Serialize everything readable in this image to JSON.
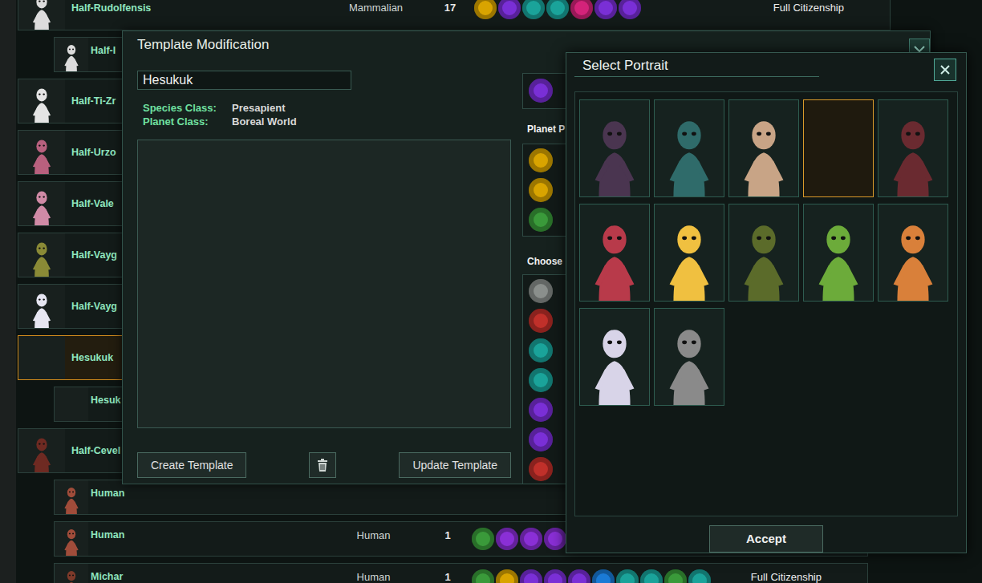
{
  "species_list": {
    "rows": [
      {
        "name": "Half-Rudolfensis",
        "kind": "species",
        "selected": false,
        "portrait_kind": "figure",
        "portrait_color": "#dcdcdc",
        "class": "Mammalian",
        "count": "17",
        "traits": [
          "#d9a400",
          "#7a2fd6",
          "#1aa39a",
          "#1aa39a",
          "#d4237a",
          "#7a2fd6",
          "#7a2fd6"
        ],
        "citizenship": "Full Citizenship"
      },
      {
        "name": "Half-I",
        "kind": "subspecies",
        "selected": false,
        "portrait_kind": "figure",
        "portrait_color": "#dcdcdc"
      },
      {
        "name": "Half-Ti-Zr",
        "kind": "species",
        "selected": false,
        "portrait_kind": "figure",
        "portrait_color": "#e4e4e4"
      },
      {
        "name": "Half-Urzo",
        "kind": "species",
        "selected": false,
        "portrait_kind": "figure",
        "portrait_color": "#b8607e"
      },
      {
        "name": "Half-Vale",
        "kind": "species",
        "selected": false,
        "portrait_kind": "figure",
        "portrait_color": "#d08aa6"
      },
      {
        "name": "Half-Vayg",
        "kind": "species",
        "selected": false,
        "portrait_kind": "figure",
        "portrait_color": "#8a8a36"
      },
      {
        "name": "Half-Vayg",
        "kind": "species",
        "selected": false,
        "portrait_kind": "figure",
        "portrait_color": "#e6e6f2"
      },
      {
        "name": "Hesukuk",
        "kind": "species",
        "selected": true,
        "portrait_kind": "empty"
      },
      {
        "name": "Hesuk",
        "kind": "subspecies",
        "selected": false,
        "portrait_kind": "empty"
      },
      {
        "name": "Half-Cevel",
        "kind": "species",
        "selected": false,
        "portrait_kind": "figure",
        "portrait_color": "#6e2a22"
      },
      {
        "name": "Human",
        "kind": "subspecies",
        "selected": false,
        "portrait_kind": "figure",
        "portrait_color": "#a04c3a"
      },
      {
        "name": "Human",
        "kind": "subspecies",
        "selected": false,
        "portrait_kind": "figure",
        "portrait_color": "#a04c3a",
        "class": "Human",
        "count": "1",
        "traits": [
          "#3a9a3a",
          "#8a2fd6",
          "#8a2fd6",
          "#8a2fd6",
          "#d4237a",
          "#1aa39a"
        ]
      },
      {
        "name": "Michar",
        "kind": "subspecies",
        "selected": false,
        "portrait_kind": "figure",
        "portrait_color": "#7e3a2a",
        "class": "Human",
        "count": "1",
        "traits": [
          "#3a9a3a",
          "#d9a400",
          "#7a2fd6",
          "#7a2fd6",
          "#7a2fd6",
          "#1a7ad6",
          "#1aa39a",
          "#1aa39a",
          "#3a9a3a",
          "#1aa39a"
        ],
        "citizenship": "Full Citizenship"
      }
    ]
  },
  "template": {
    "title": "Template Modification",
    "name": "Hesukuk",
    "species_class_label": "Species Class:",
    "species_class": "Presapient",
    "planet_class_label": "Planet Class:",
    "planet_class": "Boreal World",
    "create_button": "Create Template",
    "update_button": "Update Template",
    "planet_label": "Planet P",
    "choose_label": "Choose",
    "top_icons": [
      "#7a2fd6"
    ],
    "planet_icons": [
      "#d9a400",
      "#d9a400",
      "#3a9a3a"
    ],
    "choose_icons": [
      "#8a8f8c",
      "#c0302a",
      "#1aa39a",
      "#1aa39a",
      "#7a2fd6",
      "#7a2fd6",
      "#c0302a"
    ]
  },
  "portrait_dialog": {
    "title": "Select Portrait",
    "portraits": [
      {
        "kind": "figure",
        "color": "#4a3550",
        "selected": false
      },
      {
        "kind": "figure",
        "color": "#2f6b6a",
        "selected": false
      },
      {
        "kind": "figure",
        "color": "#c8a486",
        "selected": false
      },
      {
        "kind": "empty",
        "selected": true
      },
      {
        "kind": "figure",
        "color": "#6a2a30",
        "selected": false
      },
      {
        "kind": "figure",
        "color": "#b83a4a",
        "selected": false
      },
      {
        "kind": "figure",
        "color": "#f0c040",
        "selected": false
      },
      {
        "kind": "figure",
        "color": "#5b6b2a",
        "selected": false
      },
      {
        "kind": "figure",
        "color": "#6cab3a",
        "selected": false
      },
      {
        "kind": "figure",
        "color": "#d9803a",
        "selected": false
      },
      {
        "kind": "figure",
        "color": "#d8d4e8",
        "selected": false
      },
      {
        "kind": "figure",
        "color": "#8a8a8a",
        "selected": false
      }
    ],
    "accept_button": "Accept"
  }
}
